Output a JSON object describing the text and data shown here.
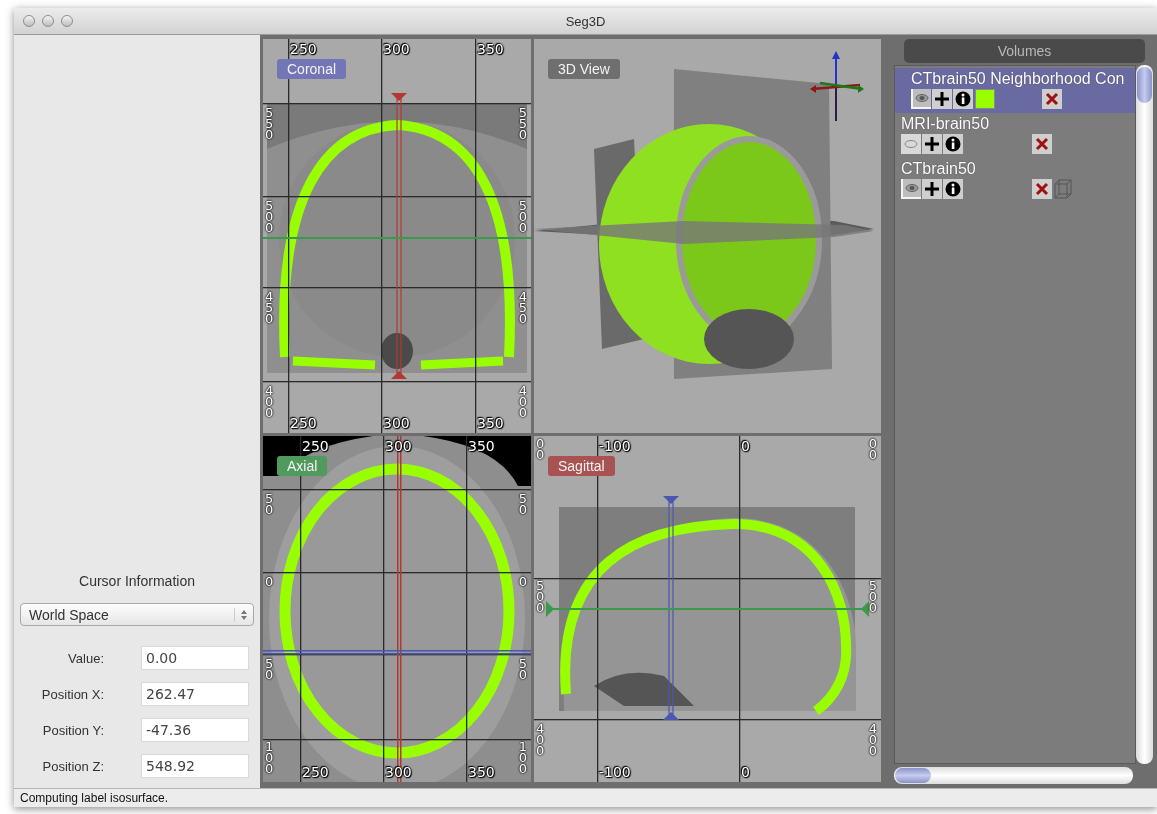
{
  "window": {
    "title": "Seg3D"
  },
  "cursor_info": {
    "title": "Cursor Information",
    "space": "World Space",
    "fields": [
      {
        "label": "Value:",
        "value": "0.00"
      },
      {
        "label": "Position X:",
        "value": "262.47"
      },
      {
        "label": "Position Y:",
        "value": "-47.36"
      },
      {
        "label": "Position Z:",
        "value": "548.92"
      }
    ]
  },
  "views": [
    {
      "kind": "coronal",
      "label": "Coronal",
      "color": "#7276b6",
      "top_ticks": [
        "250",
        "300",
        "350"
      ],
      "bottom_ticks": [
        "250",
        "300",
        "350"
      ],
      "left_ticks": [
        "550",
        "500",
        "450",
        "400"
      ],
      "right_ticks": [
        "550",
        "500",
        "450",
        "400"
      ]
    },
    {
      "kind": "volume",
      "label": "3D View",
      "color": "#6f6f6f"
    },
    {
      "kind": "axial",
      "label": "Axial",
      "color": "#4f9a5c",
      "top_ticks": [
        "250",
        "300",
        "350"
      ],
      "bottom_ticks": [
        "250",
        "300",
        "350"
      ],
      "left_ticks": [
        "50",
        "0",
        "50",
        "100"
      ],
      "right_ticks": [
        "50",
        "0",
        "50",
        "100"
      ]
    },
    {
      "kind": "sagittal",
      "label": "Sagittal",
      "color": "#a85252",
      "top_ticks": [
        "-100",
        "0"
      ],
      "bottom_ticks": [
        "-100",
        "0"
      ],
      "left_ticks": [
        "00",
        "500",
        "400"
      ],
      "right_ticks": [
        "00",
        "500",
        "400"
      ]
    }
  ],
  "volumes": {
    "title": "Volumes",
    "items": [
      {
        "name": "CTbrain50 Neighborhood Con",
        "selected": true,
        "visible": true,
        "color": "#99ff00",
        "isosurface": false
      },
      {
        "name": "MRI-brain50",
        "selected": false,
        "visible": false,
        "isosurface": false
      },
      {
        "name": "CTbrain50",
        "selected": false,
        "visible": true,
        "isosurface": true
      }
    ]
  },
  "status_bar": "Computing label isosurface."
}
